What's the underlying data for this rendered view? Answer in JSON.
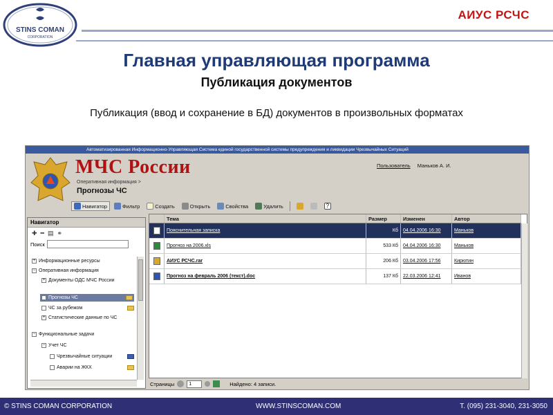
{
  "slide": {
    "brand": "АИУС РСЧС",
    "title": "Главная управляющая программа",
    "subtitle": "Публикация документов",
    "description": "Публикация (ввод и сохранение в БД) документов в произвольных форматах",
    "logo_text": "STINS COMAN",
    "logo_subtext": "CORPORATION"
  },
  "app": {
    "top_banner": "Автоматизированная Информационно-Управляющая Система единой государственной системы предупреждения и ликвидации Чрезвычайных Ситуаций",
    "org_title": "МЧС России",
    "user_label": "Пользователь",
    "user_name": "Маньков А. И.",
    "breadcrumb": "Оперативная информация >",
    "section_title": "Прогнозы ЧС",
    "toolbar": {
      "navigator": "Навигатор",
      "filter": "Фильтр",
      "create": "Создать",
      "open": "Открыть",
      "properties": "Свойства",
      "delete": "Удалить"
    },
    "navigator": {
      "title": "Навигатор",
      "search_label": "Поиск",
      "search_value": "",
      "tree": [
        {
          "label": "Информационные ресурсы",
          "expander": "+"
        },
        {
          "label": "Оперативная информация",
          "expander": "−"
        },
        {
          "label": "Документы ОДС МЧС России",
          "expander": "+"
        },
        {
          "label": "Прогнозы ЧС",
          "expander": ""
        },
        {
          "label": "ЧС за рубежом",
          "expander": ""
        },
        {
          "label": "Статистические данные по ЧС",
          "expander": "+"
        },
        {
          "label": "Функциональные задачи",
          "expander": "−"
        },
        {
          "label": "Учет ЧС",
          "expander": "−"
        },
        {
          "label": "Чрезвычайные ситуации",
          "expander": ""
        },
        {
          "label": "Аварии на ЖКХ",
          "expander": ""
        }
      ]
    },
    "grid": {
      "columns": [
        "Тема",
        "Размер",
        "Изменен",
        "Автор"
      ],
      "rows": [
        {
          "name": "Пояснительная записка",
          "size": "Кб",
          "date": "04.04.2006 16:30",
          "author": "Маньков",
          "type": "generic-doc-icon"
        },
        {
          "name": "Прогноз на 2006.xls",
          "size": "533 Кб",
          "date": "04.04.2006 16:30",
          "author": "Маньков",
          "type": "excel-file-icon"
        },
        {
          "name": "АИУС РСЧС.rar",
          "size": "206 Кб",
          "date": "03.04.2006 17:56",
          "author": "Кирютин",
          "type": "archive-file-icon"
        },
        {
          "name": "Прогноз на февраль 2006 (текст).doc",
          "size": "137 Кб",
          "date": "22.03.2006 12:41",
          "author": "Иванов",
          "type": "word-file-icon"
        }
      ]
    },
    "pager": {
      "pages_label": "Страницы",
      "page_value": "1",
      "found_text": "Найдено: 4 записи."
    }
  },
  "footer": {
    "left": "© STINS COMAN CORPORATION",
    "center": "WWW.STINSCOMAN.COM",
    "right": "T. (095) 231-3040, 231-3050"
  },
  "colors": {
    "brand_red": "#c21414",
    "title_blue": "#1e3a78",
    "footer_navy": "#2f2f75",
    "selection": "#22305c"
  }
}
